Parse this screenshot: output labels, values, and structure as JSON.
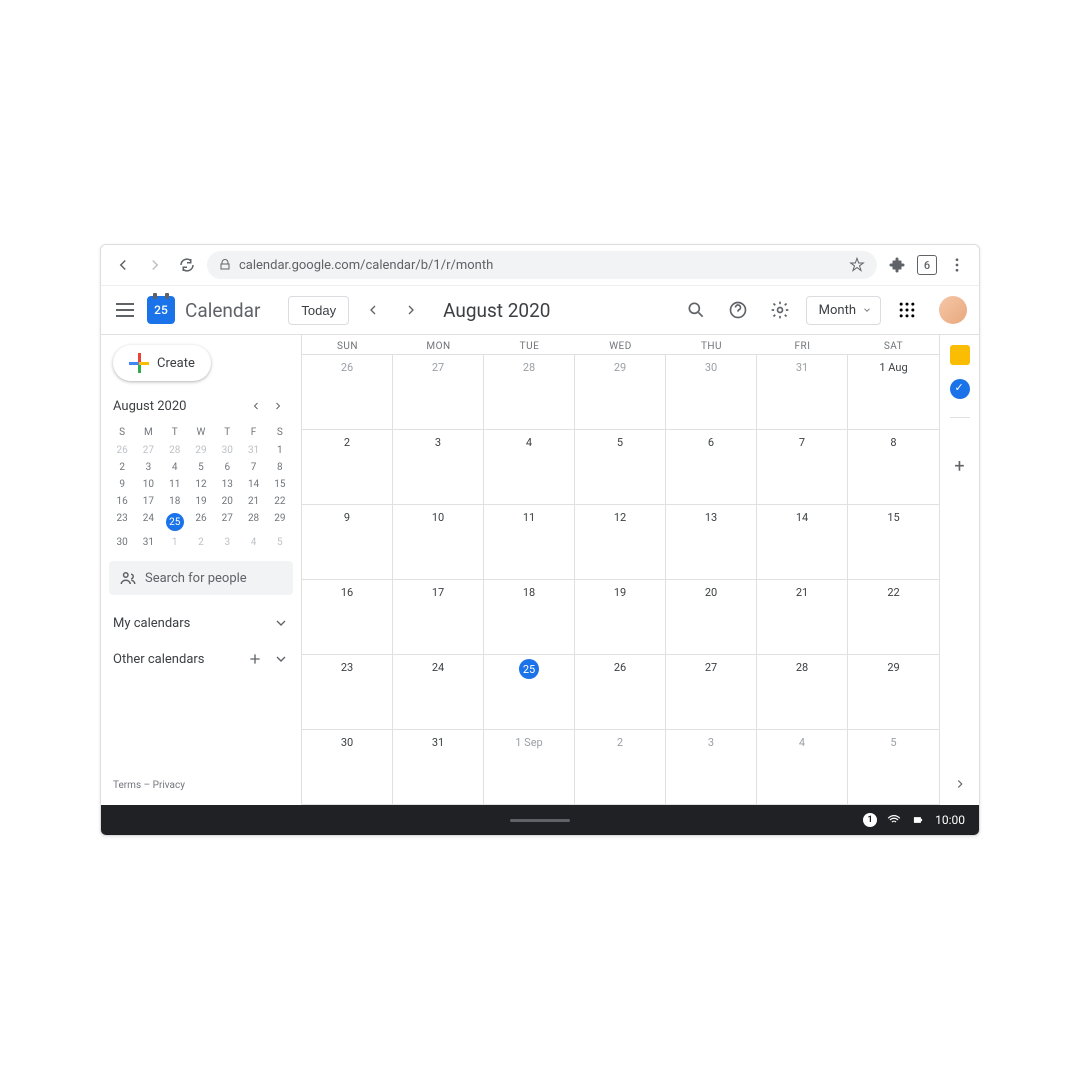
{
  "browser": {
    "url": "calendar.google.com/calendar/b/1/r/month",
    "tab_count": "6"
  },
  "header": {
    "logo_day": "25",
    "app_name": "Calendar",
    "today_label": "Today",
    "month_title": "August 2020",
    "view_label": "Month"
  },
  "mini": {
    "title": "August 2020",
    "dow": [
      "S",
      "M",
      "T",
      "W",
      "T",
      "F",
      "S"
    ],
    "rows": [
      [
        {
          "n": "26",
          "dim": true
        },
        {
          "n": "27",
          "dim": true
        },
        {
          "n": "28",
          "dim": true
        },
        {
          "n": "29",
          "dim": true
        },
        {
          "n": "30",
          "dim": true
        },
        {
          "n": "31",
          "dim": true
        },
        {
          "n": "1"
        }
      ],
      [
        {
          "n": "2"
        },
        {
          "n": "3"
        },
        {
          "n": "4"
        },
        {
          "n": "5"
        },
        {
          "n": "6"
        },
        {
          "n": "7"
        },
        {
          "n": "8"
        }
      ],
      [
        {
          "n": "9"
        },
        {
          "n": "10"
        },
        {
          "n": "11"
        },
        {
          "n": "12"
        },
        {
          "n": "13"
        },
        {
          "n": "14"
        },
        {
          "n": "15"
        }
      ],
      [
        {
          "n": "16"
        },
        {
          "n": "17"
        },
        {
          "n": "18"
        },
        {
          "n": "19"
        },
        {
          "n": "20"
        },
        {
          "n": "21"
        },
        {
          "n": "22"
        }
      ],
      [
        {
          "n": "23"
        },
        {
          "n": "24"
        },
        {
          "n": "25",
          "today": true
        },
        {
          "n": "26"
        },
        {
          "n": "27"
        },
        {
          "n": "28"
        },
        {
          "n": "29"
        }
      ],
      [
        {
          "n": "30"
        },
        {
          "n": "31"
        },
        {
          "n": "1",
          "dim": true
        },
        {
          "n": "2",
          "dim": true
        },
        {
          "n": "3",
          "dim": true
        },
        {
          "n": "4",
          "dim": true
        },
        {
          "n": "5",
          "dim": true
        }
      ]
    ]
  },
  "sidebar": {
    "create_label": "Create",
    "search_placeholder": "Search for people",
    "my_calendars": "My calendars",
    "other_calendars": "Other calendars",
    "terms": "Terms",
    "privacy": "Privacy"
  },
  "grid": {
    "dow": [
      "SUN",
      "MON",
      "TUE",
      "WED",
      "THU",
      "FRI",
      "SAT"
    ],
    "weeks": [
      [
        {
          "n": "26",
          "dim": true
        },
        {
          "n": "27",
          "dim": true
        },
        {
          "n": "28",
          "dim": true
        },
        {
          "n": "29",
          "dim": true
        },
        {
          "n": "30",
          "dim": true
        },
        {
          "n": "31",
          "dim": true
        },
        {
          "n": "1 Aug"
        }
      ],
      [
        {
          "n": "2"
        },
        {
          "n": "3"
        },
        {
          "n": "4"
        },
        {
          "n": "5"
        },
        {
          "n": "6"
        },
        {
          "n": "7"
        },
        {
          "n": "8"
        }
      ],
      [
        {
          "n": "9"
        },
        {
          "n": "10"
        },
        {
          "n": "11"
        },
        {
          "n": "12"
        },
        {
          "n": "13"
        },
        {
          "n": "14"
        },
        {
          "n": "15"
        }
      ],
      [
        {
          "n": "16"
        },
        {
          "n": "17"
        },
        {
          "n": "18"
        },
        {
          "n": "19"
        },
        {
          "n": "20"
        },
        {
          "n": "21"
        },
        {
          "n": "22"
        }
      ],
      [
        {
          "n": "23"
        },
        {
          "n": "24"
        },
        {
          "n": "25",
          "today": true
        },
        {
          "n": "26"
        },
        {
          "n": "27"
        },
        {
          "n": "28"
        },
        {
          "n": "29"
        }
      ],
      [
        {
          "n": "30"
        },
        {
          "n": "31"
        },
        {
          "n": "1 Sep",
          "dim": true
        },
        {
          "n": "2",
          "dim": true
        },
        {
          "n": "3",
          "dim": true
        },
        {
          "n": "4",
          "dim": true
        },
        {
          "n": "5",
          "dim": true
        }
      ]
    ]
  },
  "taskbar": {
    "notif_count": "1",
    "time": "10:00"
  }
}
